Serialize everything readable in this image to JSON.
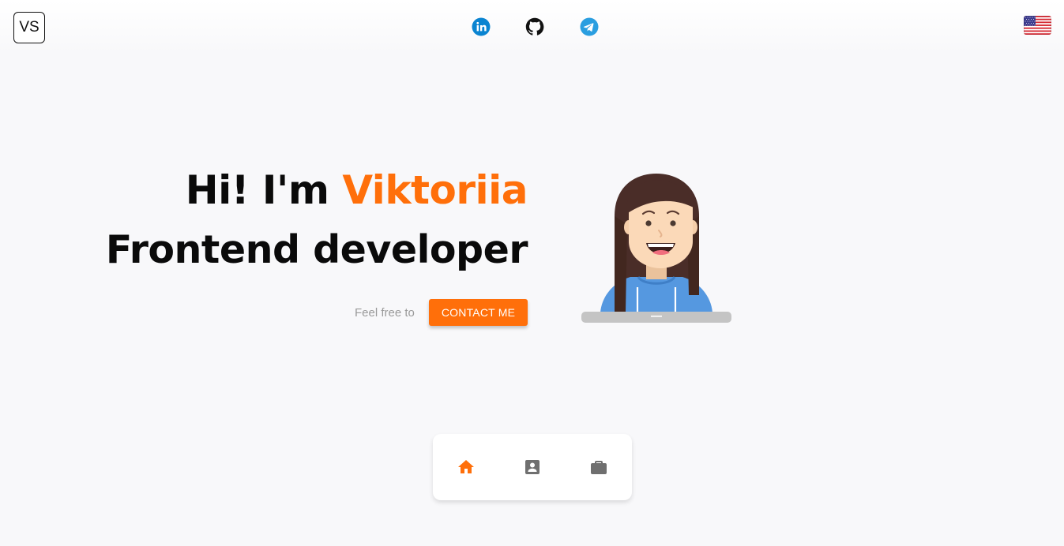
{
  "header": {
    "logo_text": "VS",
    "social_links": [
      {
        "name": "linkedin",
        "icon": "linkedin-icon",
        "color": "#0a84d1"
      },
      {
        "name": "github",
        "icon": "github-icon",
        "color": "#111111"
      },
      {
        "name": "telegram",
        "icon": "telegram-icon",
        "color": "#2a9ee0"
      }
    ],
    "language_flag": "us-flag-icon"
  },
  "hero": {
    "greeting": "Hi! I'm",
    "name": "Viktoriia",
    "role": "Frontend developer",
    "cta_text": "Feel free to",
    "cta_button": "CONTACT ME"
  },
  "bottom_nav": {
    "items": [
      {
        "icon": "home-icon",
        "active": true
      },
      {
        "icon": "contact-card-icon",
        "active": false
      },
      {
        "icon": "briefcase-icon",
        "active": false
      }
    ]
  },
  "colors": {
    "accent": "#ff6f0a",
    "text": "#0a0a0a",
    "muted": "#9a9a9a",
    "background": "#f8f8fa",
    "nav_inactive": "#6f6f6f"
  }
}
